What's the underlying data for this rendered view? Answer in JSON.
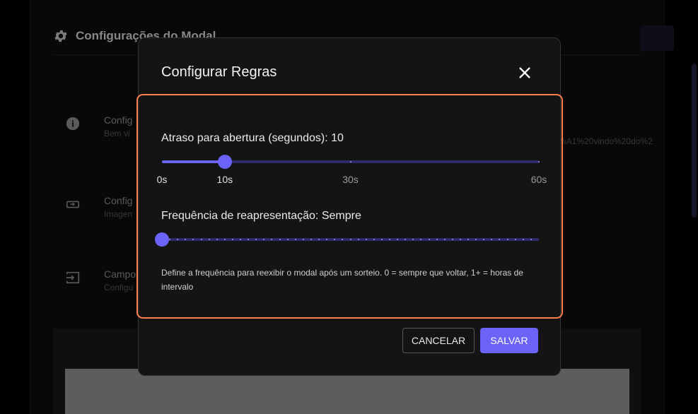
{
  "background": {
    "header_title": "Configurações do Modal",
    "rows": [
      {
        "title": "Config",
        "subtitle": "Bem vi",
        "icon": "info-icon"
      },
      {
        "title": "Config",
        "subtitle": "Imagen",
        "icon": "image-link-icon"
      },
      {
        "title": "Campo",
        "subtitle": "Configu",
        "icon": "input-icon"
      }
    ],
    "url_fragment": "%A1%20vindo%20do%2"
  },
  "modal": {
    "title": "Configurar Regras",
    "close_icon": "close-icon",
    "delay": {
      "label": "Atraso para abertura (segundos): 10",
      "value": 10,
      "min": 0,
      "max": 60,
      "marks": [
        {
          "value": 0,
          "label": "0s"
        },
        {
          "value": 10,
          "label": "10s"
        },
        {
          "value": 30,
          "label": "30s"
        },
        {
          "value": 60,
          "label": "60s"
        }
      ]
    },
    "frequency": {
      "label": "Frequência de reapresentação: Sempre",
      "value": 0,
      "min": 0,
      "max": 48
    },
    "help_text": "Define a frequência para reexibir o modal após um sorteio. 0 = sempre que voltar, 1+ = horas de intervalo",
    "cancel_label": "CANCELAR",
    "save_label": "SALVAR"
  },
  "colors": {
    "accent": "#6a63f5",
    "focus_border": "#ff7f50",
    "modal_bg": "#141414"
  }
}
